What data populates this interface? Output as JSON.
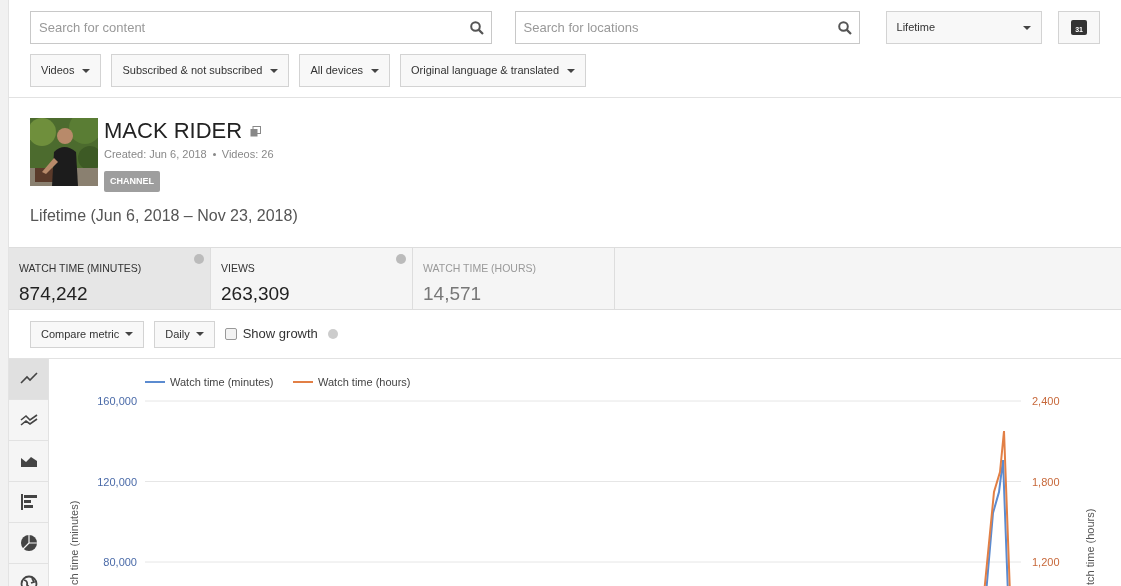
{
  "filters": {
    "content_search": {
      "placeholder": "Search for content"
    },
    "location_search": {
      "placeholder": "Search for locations"
    },
    "period": "Lifetime",
    "calendar_day": "31",
    "dropdowns": [
      "Videos",
      "Subscribed & not subscribed",
      "All devices",
      "Original language & translated"
    ]
  },
  "channel": {
    "name": "MACK RIDER",
    "created": "Created: Jun 6, 2018",
    "videos": "Videos: 26",
    "badge": "CHANNEL",
    "range": "Lifetime (Jun 6, 2018 – Nov 23, 2018)"
  },
  "metrics": [
    {
      "label": "WATCH TIME (MINUTES)",
      "value": "874,242",
      "selected": true,
      "dimmed": false,
      "help": true
    },
    {
      "label": "VIEWS",
      "value": "263,309",
      "selected": false,
      "dimmed": false,
      "help": true
    },
    {
      "label": "WATCH TIME (HOURS)",
      "value": "14,571",
      "selected": false,
      "dimmed": true,
      "help": false
    }
  ],
  "controls": {
    "compare": "Compare metric",
    "interval": "Daily",
    "show_growth": {
      "label": "Show growth",
      "checked": false
    }
  },
  "chart_types": [
    {
      "kind": "line",
      "selected": true
    },
    {
      "kind": "multiline",
      "selected": false
    },
    {
      "kind": "area",
      "selected": false
    },
    {
      "kind": "bar",
      "selected": false
    },
    {
      "kind": "pie",
      "selected": false
    },
    {
      "kind": "map",
      "selected": false
    }
  ],
  "chart": {
    "ylabel": "ch time (minutes)",
    "y2label": "tch time (hours)",
    "yticks": [
      "160,000",
      "120,000",
      "80,000"
    ],
    "y2ticks": [
      "2,400",
      "1,800",
      "1,200"
    ],
    "series": [
      {
        "name": "Watch time (minutes)",
        "color": "#5b8bd0"
      },
      {
        "name": "Watch time (hours)",
        "color": "#e27f45"
      }
    ]
  }
}
